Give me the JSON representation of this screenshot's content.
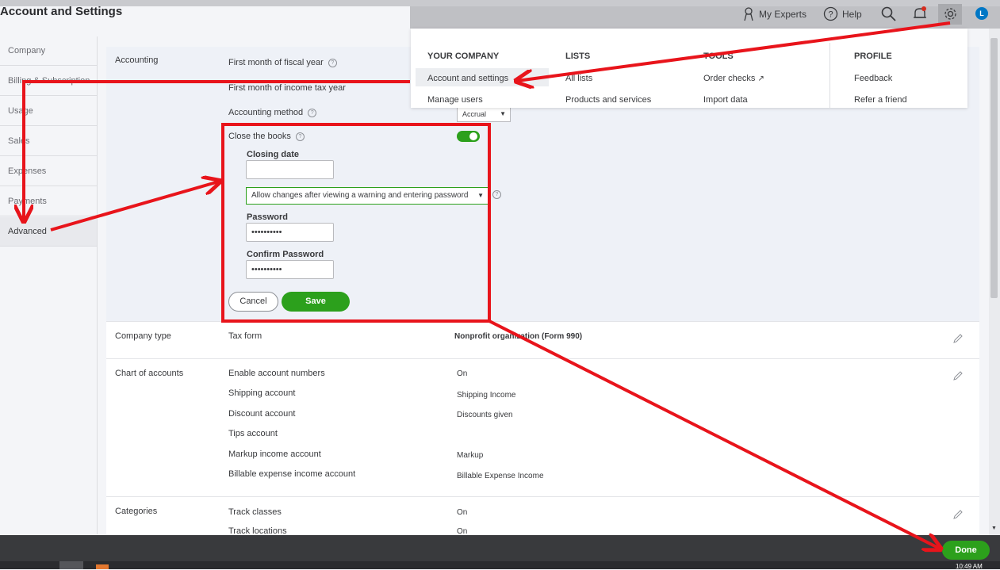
{
  "page_title": "Account and Settings",
  "sidebar": {
    "items": [
      {
        "label": "Company"
      },
      {
        "label": "Billing & Subscription"
      },
      {
        "label": "Usage"
      },
      {
        "label": "Sales"
      },
      {
        "label": "Expenses"
      },
      {
        "label": "Payments"
      },
      {
        "label": "Advanced"
      }
    ]
  },
  "topbar": {
    "my_experts": "My Experts",
    "help": "Help",
    "avatar_initial": "L"
  },
  "dropdown": {
    "your_company": {
      "heading": "YOUR COMPANY",
      "items": [
        "Account and settings",
        "Manage users"
      ]
    },
    "lists": {
      "heading": "LISTS",
      "items": [
        "All lists",
        "Products and services"
      ]
    },
    "tools": {
      "heading": "TOOLS",
      "items": [
        "Order checks",
        "Import data"
      ]
    },
    "profile": {
      "heading": "PROFILE",
      "items": [
        "Feedback",
        "Refer a friend"
      ]
    }
  },
  "accounting": {
    "section_label": "Accounting",
    "first_month_fiscal": "First month of fiscal year",
    "first_month_tax": "First month of income tax year",
    "accounting_method": "Accounting method",
    "accounting_method_value": "Accrual",
    "close_books": "Close the books",
    "closing_date_label": "Closing date",
    "closing_date_value": "",
    "allow_changes": "Allow changes after viewing a warning and entering password",
    "password_label": "Password",
    "password_value": "••••••••••",
    "confirm_password_label": "Confirm Password",
    "confirm_password_value": "••••••••••",
    "cancel": "Cancel",
    "save": "Save"
  },
  "company_type": {
    "section_label": "Company type",
    "tax_form_label": "Tax form",
    "tax_form_value": "Nonprofit organization (Form 990)"
  },
  "chart_of_accounts": {
    "section_label": "Chart of accounts",
    "rows": [
      {
        "label": "Enable account numbers",
        "value": "On"
      },
      {
        "label": "Shipping account",
        "value": "Shipping Income"
      },
      {
        "label": "Discount account",
        "value": "Discounts given"
      },
      {
        "label": "Tips account",
        "value": ""
      },
      {
        "label": "Markup income account",
        "value": "Markup"
      },
      {
        "label": "Billable expense income account",
        "value": "Billable Expense Income"
      }
    ]
  },
  "categories": {
    "section_label": "Categories",
    "rows": [
      {
        "label": "Track classes",
        "value": "On"
      },
      {
        "label": "Track locations",
        "value": "On"
      }
    ]
  },
  "footer": {
    "done": "Done",
    "clock": "10:49 AM"
  },
  "colors": {
    "brand_green": "#2ca01c",
    "annotation_red": "#e8141b"
  }
}
